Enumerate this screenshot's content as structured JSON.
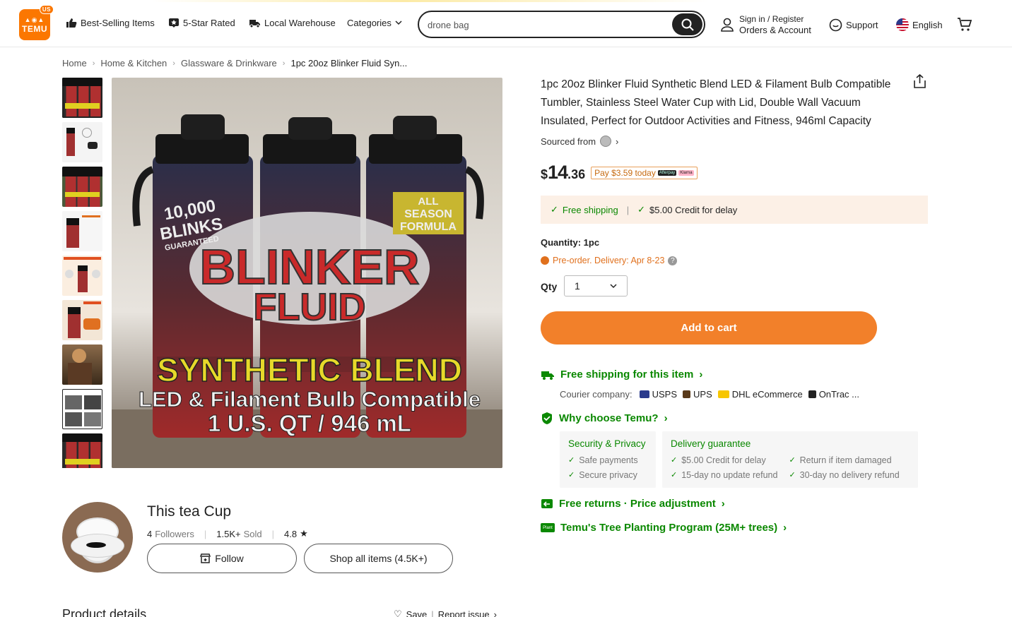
{
  "header": {
    "logo_text": "TEMU",
    "logo_badge": "US",
    "nav": {
      "best_selling": "Best-Selling Items",
      "five_star": "5-Star Rated",
      "local_warehouse": "Local Warehouse",
      "categories": "Categories"
    },
    "search": {
      "value": "drone bag"
    },
    "account": {
      "line1": "Sign in / Register",
      "line2": "Orders & Account"
    },
    "support": "Support",
    "language": "English"
  },
  "breadcrumb": [
    "Home",
    "Home & Kitchen",
    "Glassware & Drinkware",
    "1pc 20oz Blinker Fluid Syn..."
  ],
  "gallery": {
    "main_texts": {
      "guarantee1": "10,000",
      "guarantee2": "BLINKS",
      "guarantee3": "GUARANTEED",
      "season1": "ALL",
      "season2": "SEASON",
      "season3": "FORMULA",
      "brand1": "BLINKER",
      "brand2": "FLUID",
      "line1": "SYNTHETIC BLEND",
      "line2": "LED & Filament Bulb Compatible",
      "line3": "1 U.S. QT / 946 mL"
    }
  },
  "product": {
    "title": "1pc 20oz Blinker Fluid Synthetic Blend LED & Filament Bulb Compatible Tumbler, Stainless Steel Water Cup with Lid, Double Wall Vacuum Insulated, Perfect for Outdoor Activities and Fitness, 946ml Capacity",
    "sourced_from": "Sourced from",
    "price_currency": "$",
    "price_int": "14",
    "price_dec": ".36",
    "pay_today": "Pay $3.59 today",
    "pay_badge1": "Afterpay",
    "pay_badge2": "Klarna",
    "free_shipping": "Free shipping",
    "credit_delay": "$5.00 Credit for delay",
    "quantity_text": "Quantity: 1pc",
    "preorder": "Pre-order. Delivery: Apr 8-23",
    "qty_label": "Qty",
    "qty_value": "1",
    "add_to_cart": "Add to cart",
    "free_shipping_item": "Free shipping for this item",
    "courier_label": "Courier company:",
    "couriers": [
      "USPS",
      "UPS",
      "DHL eCommerce",
      "OnTrac ..."
    ],
    "why_choose": "Why choose Temu?",
    "security": {
      "title": "Security & Privacy",
      "items": [
        "Safe payments",
        "Secure privacy"
      ]
    },
    "delivery": {
      "title": "Delivery guarantee",
      "col1": [
        "$5.00 Credit for delay",
        "15-day no update refund"
      ],
      "col2": [
        "Return if item damaged",
        "30-day no delivery refund"
      ]
    },
    "free_returns": "Free returns · Price adjustment",
    "tree_badge": "Plant",
    "tree_program": "Temu's Tree Planting Program (25M+ trees)"
  },
  "store": {
    "name": "This tea Cup",
    "followers_num": "4",
    "followers_label": "Followers",
    "sold_num": "1.5K+",
    "sold_label": "Sold",
    "rating": "4.8",
    "follow": "Follow",
    "shop_all": "Shop all items (4.5K+)"
  },
  "details": {
    "title": "Product details",
    "save": "Save",
    "report": "Report issue"
  },
  "colors": {
    "brand": "#fb7701",
    "cta": "#f2802a",
    "green": "#0a8800"
  }
}
